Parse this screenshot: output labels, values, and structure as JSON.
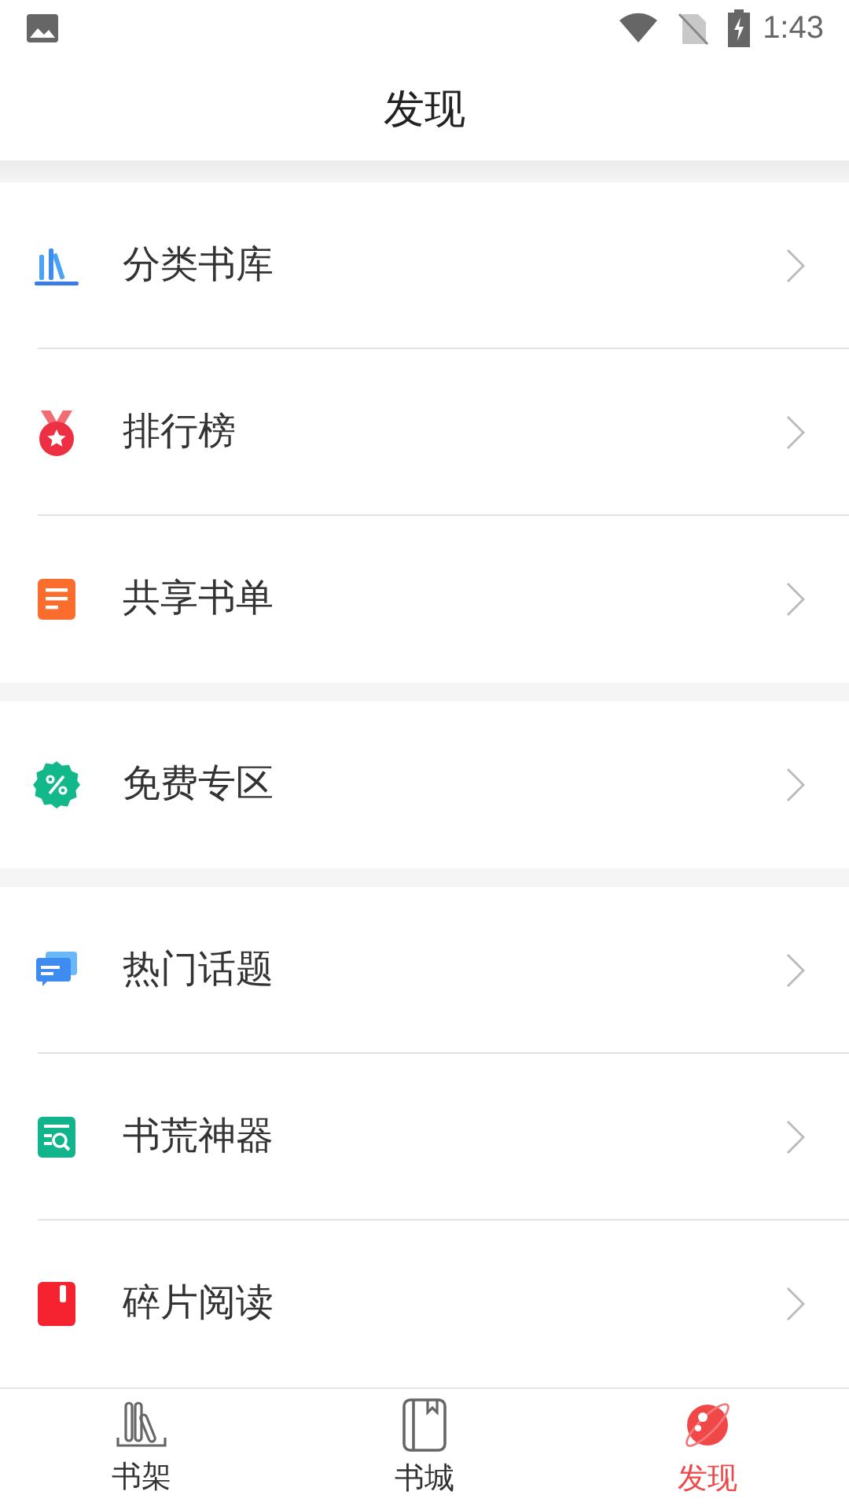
{
  "status_bar": {
    "time": "1:43"
  },
  "header": {
    "title": "发现"
  },
  "groups": [
    {
      "items": [
        {
          "kind": "library",
          "label": "分类书库"
        },
        {
          "kind": "medal",
          "label": "排行榜"
        },
        {
          "kind": "list",
          "label": "共享书单"
        }
      ]
    },
    {
      "items": [
        {
          "kind": "discount",
          "label": "免费专区"
        }
      ]
    },
    {
      "items": [
        {
          "kind": "chat",
          "label": "热门话题"
        },
        {
          "kind": "finder",
          "label": "书荒神器"
        },
        {
          "kind": "fragment",
          "label": "碎片阅读"
        }
      ]
    }
  ],
  "tabs": [
    {
      "kind": "shelf",
      "label": "书架",
      "selected": false
    },
    {
      "kind": "store",
      "label": "书城",
      "selected": false
    },
    {
      "kind": "discover",
      "label": "发现",
      "selected": true
    }
  ]
}
